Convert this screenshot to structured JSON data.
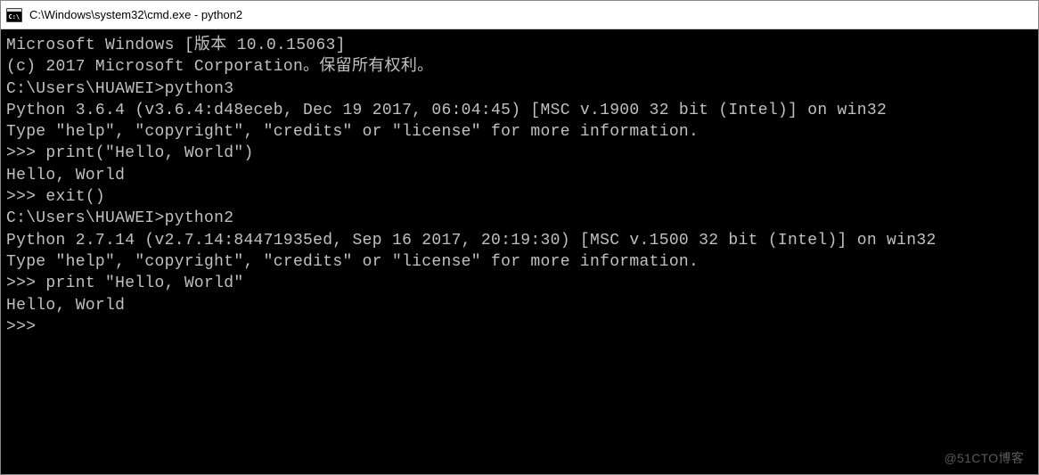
{
  "window": {
    "title": "C:\\Windows\\system32\\cmd.exe - python2"
  },
  "terminal": {
    "lines": [
      "Microsoft Windows [版本 10.0.15063]",
      "(c) 2017 Microsoft Corporation。保留所有权利。",
      "",
      "C:\\Users\\HUAWEI>python3",
      "Python 3.6.4 (v3.6.4:d48eceb, Dec 19 2017, 06:04:45) [MSC v.1900 32 bit (Intel)] on win32",
      "Type \"help\", \"copyright\", \"credits\" or \"license\" for more information.",
      ">>> print(\"Hello, World\")",
      "Hello, World",
      ">>> exit()",
      "",
      "C:\\Users\\HUAWEI>python2",
      "Python 2.7.14 (v2.7.14:84471935ed, Sep 16 2017, 20:19:30) [MSC v.1500 32 bit (Intel)] on win32",
      "Type \"help\", \"copyright\", \"credits\" or \"license\" for more information.",
      ">>> print \"Hello, World\"",
      "Hello, World",
      ">>> "
    ]
  },
  "watermark": {
    "text": "@51CTO博客"
  }
}
